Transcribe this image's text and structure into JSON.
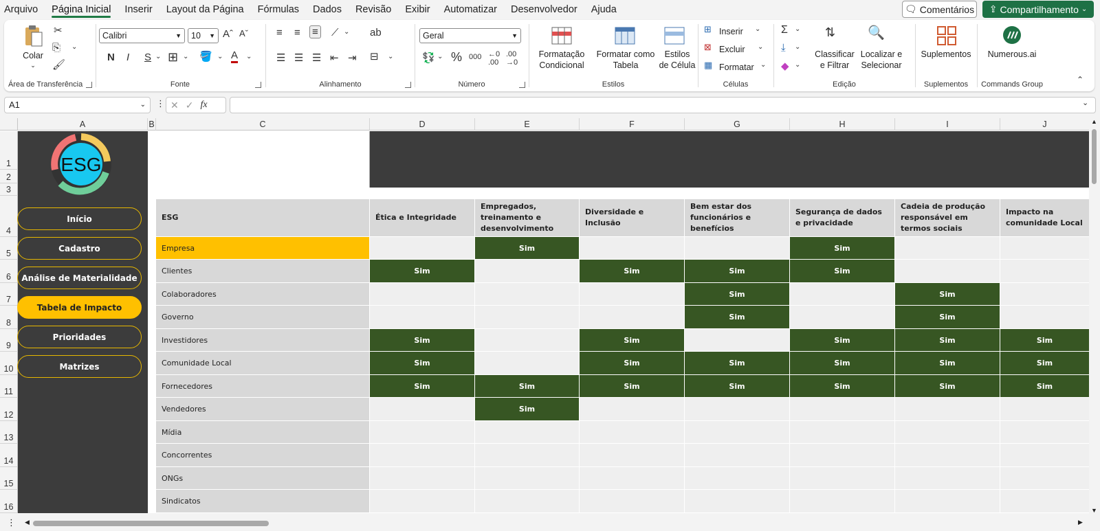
{
  "menu": {
    "items": [
      "Arquivo",
      "Página Inicial",
      "Inserir",
      "Layout da Página",
      "Fórmulas",
      "Dados",
      "Revisão",
      "Exibir",
      "Automatizar",
      "Desenvolvedor",
      "Ajuda"
    ],
    "active": "Página Inicial",
    "comments_label": "Comentários",
    "share_label": "Compartilhamento"
  },
  "ribbon": {
    "clipboard": {
      "paste_label": "Colar",
      "group_label": "Área de Transferência"
    },
    "font": {
      "font_name": "Calibri",
      "font_size": "10",
      "group_label": "Fonte",
      "bold": "N",
      "italic": "I",
      "underline": "S"
    },
    "alignment": {
      "group_label": "Alinhamento"
    },
    "number": {
      "format": "Geral",
      "group_label": "Número",
      "percent": "%",
      "thousands": "000"
    },
    "styles": {
      "conditional": "Formatação Condicional",
      "as_table": "Formatar como Tabela",
      "cell_styles": "Estilos de Célula",
      "group_label": "Estilos"
    },
    "cells": {
      "insert": "Inserir",
      "delete": "Excluir",
      "format": "Formatar",
      "group_label": "Células"
    },
    "editing": {
      "sort": "Classificar e Filtrar",
      "find": "Localizar e Selecionar",
      "group_label": "Edição"
    },
    "addins": {
      "label": "Suplementos",
      "group_label": "Suplementos"
    },
    "numerous": {
      "label": "Numerous.ai",
      "group_label": "Commands Group"
    }
  },
  "formula_bar": {
    "name_box": "A1",
    "fx": "fx",
    "value": ""
  },
  "columns": [
    "A",
    "B",
    "C",
    "D",
    "E",
    "F",
    "G",
    "H",
    "I",
    "J"
  ],
  "rows": [
    "1",
    "2",
    "3",
    "4",
    "5",
    "6",
    "7",
    "8",
    "9",
    "10",
    "11",
    "12",
    "13",
    "14",
    "15",
    "16"
  ],
  "logo_text": "ESG",
  "nav": [
    "Início",
    "Cadastro",
    "Análise de Materialidade",
    "Tabela de Impacto",
    "Prioridades",
    "Matrizes"
  ],
  "nav_active": "Tabela de Impacto",
  "table": {
    "corner_header": "ESG",
    "headers": [
      "Ética e Integridade",
      "Empregados, treinamento e desenvolvimento",
      "Diversidade e Inclusão",
      "Bem estar dos funcionários e benefícios",
      "Segurança de dados e privacidade",
      "Cadeia de produção responsável em termos sociais",
      "Impacto na comunidade Local"
    ],
    "rows": [
      {
        "label": "Empresa",
        "cells": [
          "",
          "Sim",
          "",
          "",
          "Sim",
          "",
          ""
        ]
      },
      {
        "label": "Clientes",
        "cells": [
          "Sim",
          "",
          "Sim",
          "Sim",
          "Sim",
          "",
          ""
        ]
      },
      {
        "label": "Colaboradores",
        "cells": [
          "",
          "",
          "",
          "Sim",
          "",
          "Sim",
          ""
        ]
      },
      {
        "label": "Governo",
        "cells": [
          "",
          "",
          "",
          "Sim",
          "",
          "Sim",
          ""
        ]
      },
      {
        "label": "Investidores",
        "cells": [
          "Sim",
          "",
          "Sim",
          "",
          "Sim",
          "Sim",
          "Sim"
        ]
      },
      {
        "label": "Comunidade Local",
        "cells": [
          "Sim",
          "",
          "Sim",
          "Sim",
          "Sim",
          "Sim",
          "Sim"
        ]
      },
      {
        "label": "Fornecedores",
        "cells": [
          "Sim",
          "Sim",
          "Sim",
          "Sim",
          "Sim",
          "Sim",
          "Sim"
        ]
      },
      {
        "label": "Vendedores",
        "cells": [
          "",
          "Sim",
          "",
          "",
          "",
          "",
          ""
        ]
      },
      {
        "label": "Mídia",
        "cells": [
          "",
          "",
          "",
          "",
          "",
          "",
          ""
        ]
      },
      {
        "label": "Concorrentes",
        "cells": [
          "",
          "",
          "",
          "",
          "",
          "",
          ""
        ]
      },
      {
        "label": "ONGs",
        "cells": [
          "",
          "",
          "",
          "",
          "",
          "",
          ""
        ]
      },
      {
        "label": "Sindicatos",
        "cells": [
          "",
          "",
          "",
          "",
          "",
          "",
          ""
        ]
      }
    ]
  },
  "colors": {
    "accent": "#1e7145",
    "dark_panel": "#3c3c3c",
    "nav_active": "#ffc000",
    "cell_green": "#375623",
    "highlight": "#ffc000"
  }
}
